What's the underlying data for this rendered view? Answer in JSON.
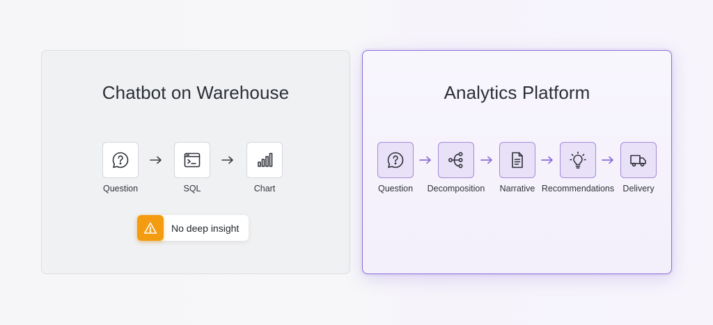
{
  "left_panel": {
    "title": "Chatbot on Warehouse",
    "nodes": [
      {
        "label": "Question",
        "icon": "question-bubble-icon"
      },
      {
        "label": "SQL",
        "icon": "terminal-icon"
      },
      {
        "label": "Chart",
        "icon": "bar-chart-icon"
      }
    ],
    "warning": {
      "text": "No deep insight",
      "icon": "warning-triangle-icon",
      "color": "#f39c12"
    }
  },
  "right_panel": {
    "title": "Analytics Platform",
    "accent": "#8b6ed6",
    "nodes": [
      {
        "label": "Question",
        "icon": "question-bubble-icon"
      },
      {
        "label": "Decomposition",
        "icon": "branch-icon"
      },
      {
        "label": "Narrative",
        "icon": "document-icon"
      },
      {
        "label": "Recommendations",
        "icon": "lightbulb-icon"
      },
      {
        "label": "Delivery",
        "icon": "truck-icon"
      }
    ]
  }
}
